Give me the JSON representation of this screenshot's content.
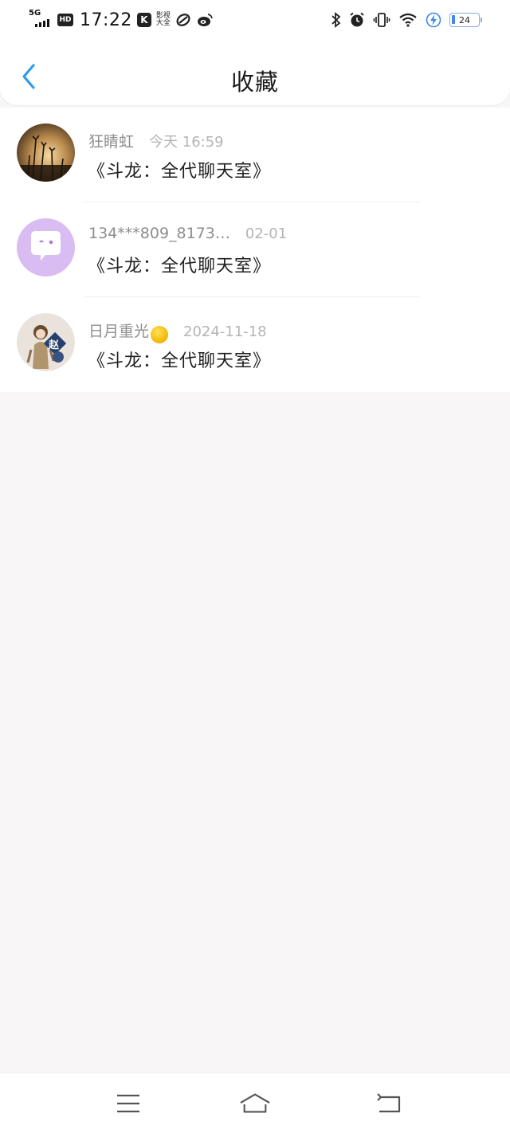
{
  "status_bar": {
    "network": "5G",
    "hd": "HD",
    "time": "17:22",
    "app_k": "K",
    "app_text": "影视大全",
    "battery": "24"
  },
  "header": {
    "title": "收藏",
    "back_icon": "chevron-left-icon",
    "accent_color": "#2f9bea"
  },
  "favorites": [
    {
      "user": "狂睛虹",
      "time": "今天 16:59",
      "title": "《斗龙：全代聊天室》",
      "avatar": "sunset-grass-photo"
    },
    {
      "user": "134***809_8173…",
      "time": "02-01",
      "title": "《斗龙：全代聊天室》",
      "avatar": "chat-bubble-default"
    },
    {
      "user": "日月重光",
      "time": "2024-11-18",
      "title": "《斗龙：全代聊天室》",
      "avatar": "character-badge-photo",
      "avatar_badge": "赵"
    }
  ],
  "bottom_nav": {
    "menu_icon": "menu-icon",
    "home_icon": "home-icon",
    "back_icon": "return-icon"
  }
}
